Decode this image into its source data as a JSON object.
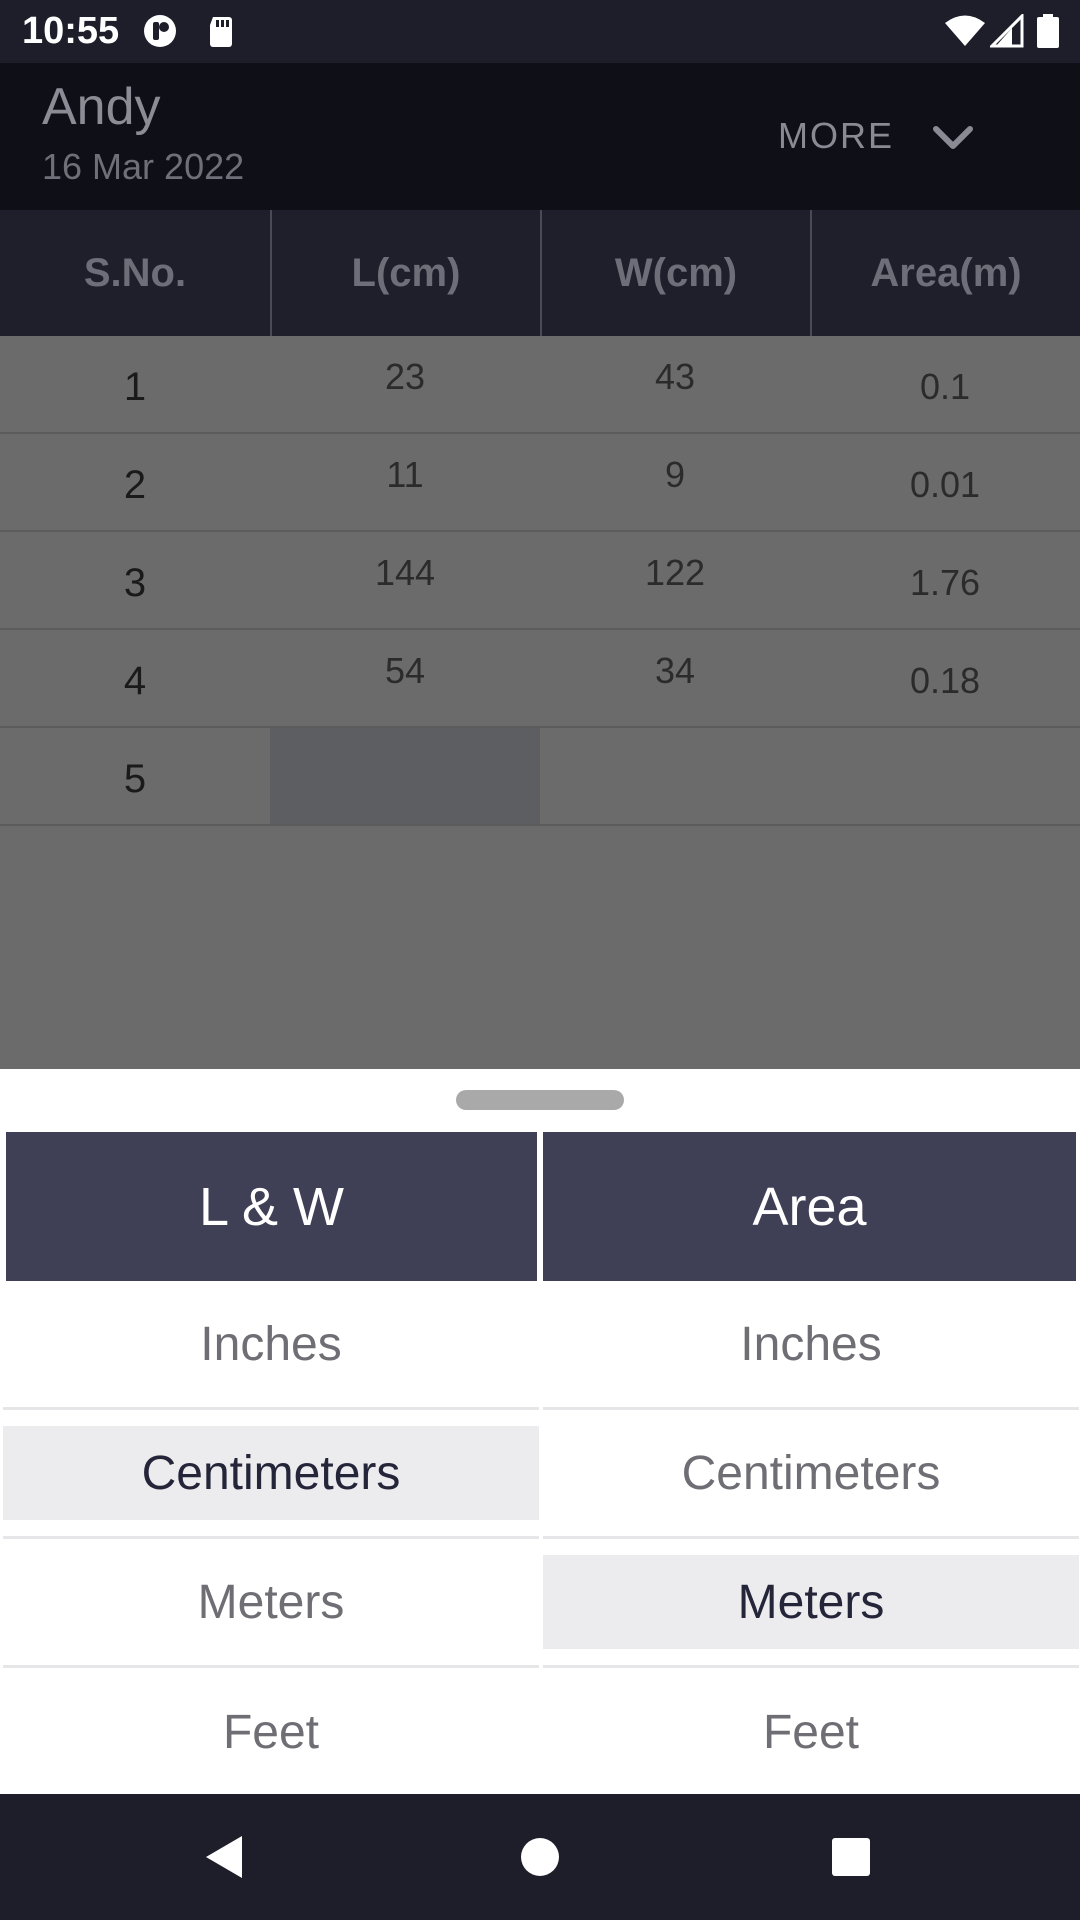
{
  "status_bar": {
    "time": "10:55",
    "icons": [
      "notification-icon",
      "sd-card-icon",
      "wifi-icon",
      "signal-icon",
      "battery-icon"
    ]
  },
  "header": {
    "title": "Andy",
    "date": "16 Mar 2022",
    "more_label": "MORE",
    "more_icon": "chevron-down-icon"
  },
  "table": {
    "columns": [
      "S.No.",
      "L(cm)",
      "W(cm)",
      "Area(m)"
    ],
    "rows": [
      {
        "sno": "1",
        "length": "23",
        "width": "43",
        "area": "0.1"
      },
      {
        "sno": "2",
        "length": "11",
        "width": "9",
        "area": "0.01"
      },
      {
        "sno": "3",
        "length": "144",
        "width": "122",
        "area": "1.76"
      },
      {
        "sno": "4",
        "length": "54",
        "width": "34",
        "area": "0.18"
      },
      {
        "sno": "5",
        "length": "",
        "width": "",
        "area": ""
      }
    ]
  },
  "unit_sheet": {
    "lw": {
      "title": "L & W",
      "options": [
        "Inches",
        "Centimeters",
        "Meters",
        "Feet"
      ],
      "selected": "Centimeters"
    },
    "area": {
      "title": "Area",
      "options": [
        "Inches",
        "Centimeters",
        "Meters",
        "Feet"
      ],
      "selected": "Meters"
    }
  },
  "colors": {
    "header_bg": "#0f0f17",
    "sheet_header_bg": "#3f3f56",
    "selected_bg": "#ececef",
    "scrim": "#6b6b6b"
  },
  "nav_bar": {
    "icons": [
      "back-icon",
      "home-icon",
      "recents-icon"
    ]
  }
}
